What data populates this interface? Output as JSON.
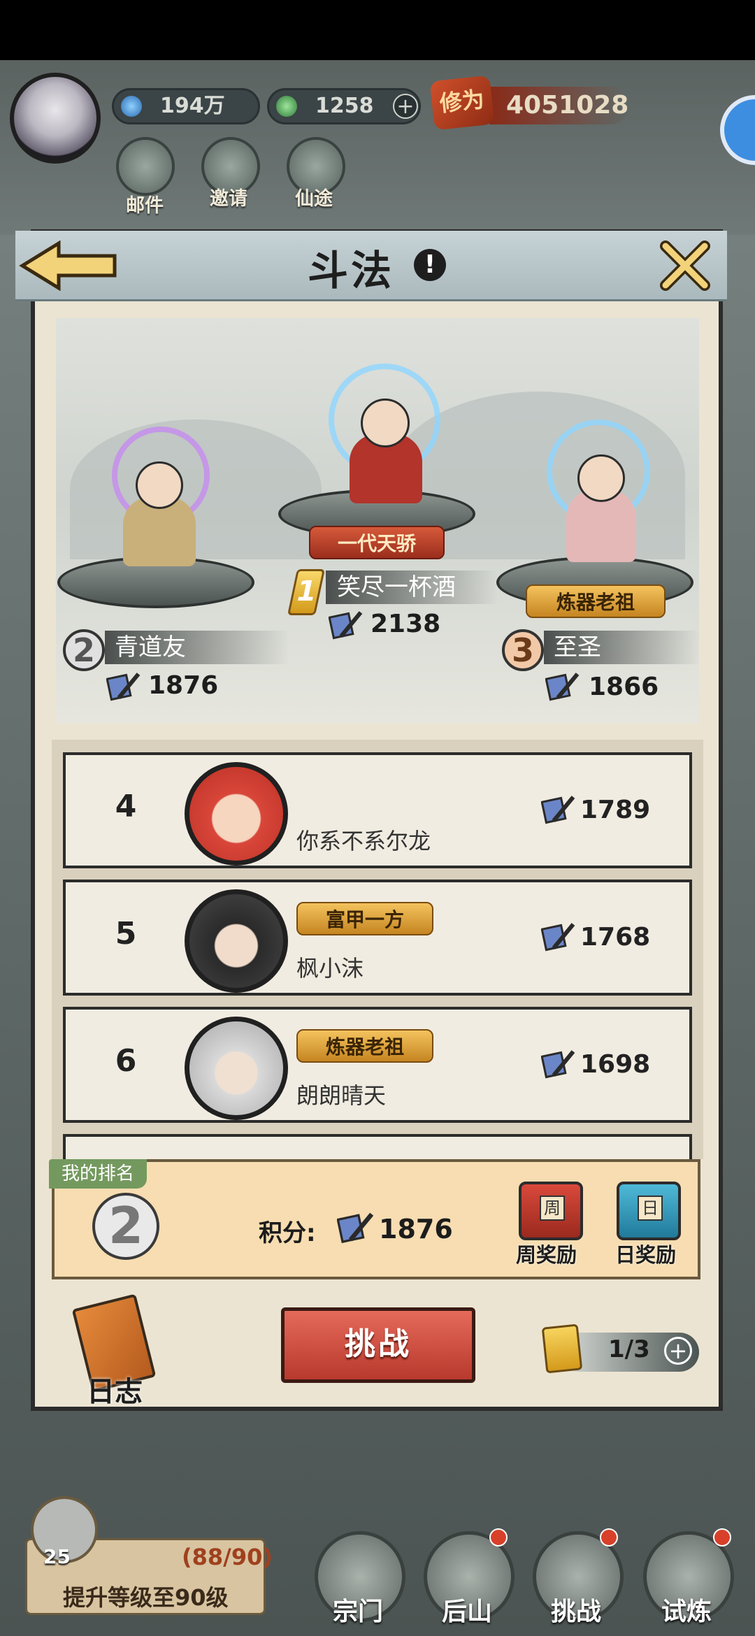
{
  "hud": {
    "currency1": "194万",
    "currency2": "1258",
    "xiuwei_label": "修为",
    "xiuwei_value": "4051028",
    "buttons": [
      "邮件",
      "邀请",
      "仙途"
    ]
  },
  "panel": {
    "title": "斗法"
  },
  "podium": [
    {
      "rank": "1",
      "name": "笑尽一杯酒",
      "power": "2138",
      "title": "一代天骄"
    },
    {
      "rank": "2",
      "name": "青道友",
      "power": "1876",
      "title": ""
    },
    {
      "rank": "3",
      "name": "至圣",
      "power": "1866",
      "title": "炼器老祖"
    }
  ],
  "list": [
    {
      "rank": "4",
      "name": "你系不系尔龙",
      "power": "1789",
      "title": ""
    },
    {
      "rank": "5",
      "name": "枫小沫",
      "power": "1768",
      "title": "富甲一方"
    },
    {
      "rank": "6",
      "name": "朗朗晴天",
      "power": "1698",
      "title": "炼器老祖"
    }
  ],
  "my_rank": {
    "tag": "我的排名",
    "rank": "2",
    "score_label": "积分:",
    "score": "1876",
    "weekly_chest_char": "周",
    "weekly_reward": "周奖励",
    "daily_chest_char": "日",
    "daily_reward": "日奖励"
  },
  "controls": {
    "log": "日志",
    "challenge": "挑战",
    "tickets": "1/3"
  },
  "bottom": {
    "task_level": "25",
    "task_progress": "(88/90)",
    "task_text": "提升等级至90级",
    "nav": [
      "宗门",
      "后山",
      "挑战",
      "试炼"
    ]
  },
  "colors": {
    "panel_bg": "#ece4d2",
    "challenge_btn": "#c8463a",
    "my_rank_bg": "#f7ddb1",
    "rank_tag": "#74995f"
  }
}
